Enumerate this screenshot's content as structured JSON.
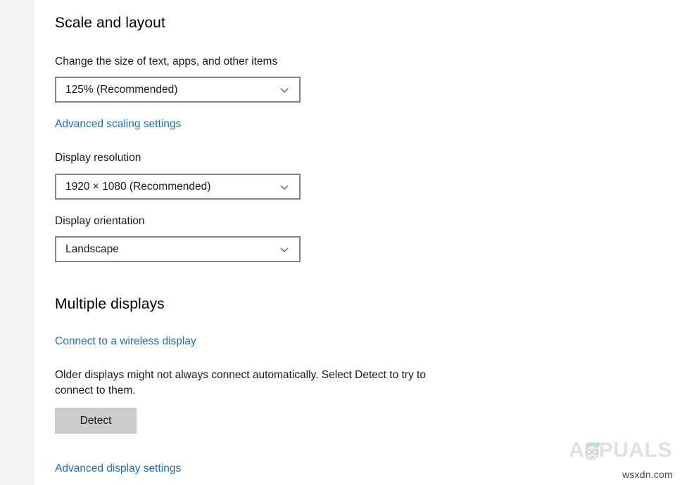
{
  "sections": {
    "scale_and_layout": {
      "heading": "Scale and layout",
      "scale_label": "Change the size of text, apps, and other items",
      "scale_value": "125% (Recommended)",
      "advanced_scaling_link": "Advanced scaling settings",
      "resolution_label": "Display resolution",
      "resolution_value": "1920 × 1080 (Recommended)",
      "orientation_label": "Display orientation",
      "orientation_value": "Landscape"
    },
    "multiple_displays": {
      "heading": "Multiple displays",
      "wireless_link": "Connect to a wireless display",
      "description": "Older displays might not always connect automatically. Select Detect to try to connect to them.",
      "detect_button": "Detect",
      "advanced_display_link": "Advanced display settings"
    }
  },
  "watermark": {
    "brand": "APPUALS",
    "site": "wsxdn.com"
  },
  "colors": {
    "link": "#1f6fb5",
    "text": "#1a1a1a",
    "combo_border": "#858585",
    "button_face": "#cccccc",
    "rail": "#f5f5f5"
  }
}
